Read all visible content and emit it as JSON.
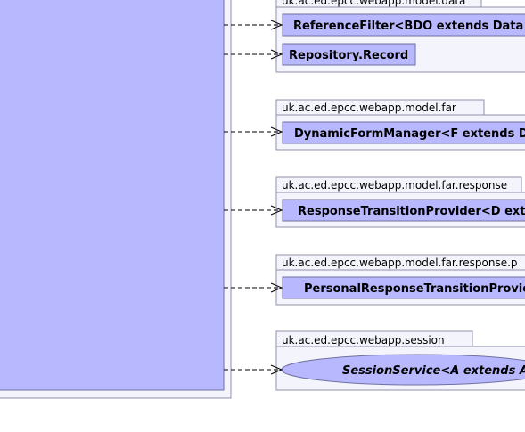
{
  "colors": {
    "class_fill": "#b8b8ff",
    "package_fill": "#f4f4fc",
    "package_stroke": "#9090a8",
    "class_stroke": "#7070a0",
    "arrow": "#000000"
  },
  "packages": [
    {
      "name": "uk.ac.ed.epcc.webapp.model.data",
      "items": [
        {
          "label": "ReferenceFilter<BDO extends Data",
          "kind": "class"
        },
        {
          "label": "Repository.Record",
          "kind": "class"
        }
      ]
    },
    {
      "name": "uk.ac.ed.epcc.webapp.model.far",
      "items": [
        {
          "label": "DynamicFormManager<F extends D",
          "kind": "class"
        }
      ]
    },
    {
      "name": "uk.ac.ed.epcc.webapp.model.far.response",
      "items": [
        {
          "label": "ResponseTransitionProvider<D ext",
          "kind": "class"
        }
      ]
    },
    {
      "name": "uk.ac.ed.epcc.webapp.model.far.response.p",
      "items": [
        {
          "label": "PersonalResponseTransitionProvic",
          "kind": "class"
        }
      ]
    },
    {
      "name": "uk.ac.ed.epcc.webapp.session",
      "items": [
        {
          "label": "SessionService<A extends A",
          "kind": "interface"
        }
      ]
    }
  ]
}
